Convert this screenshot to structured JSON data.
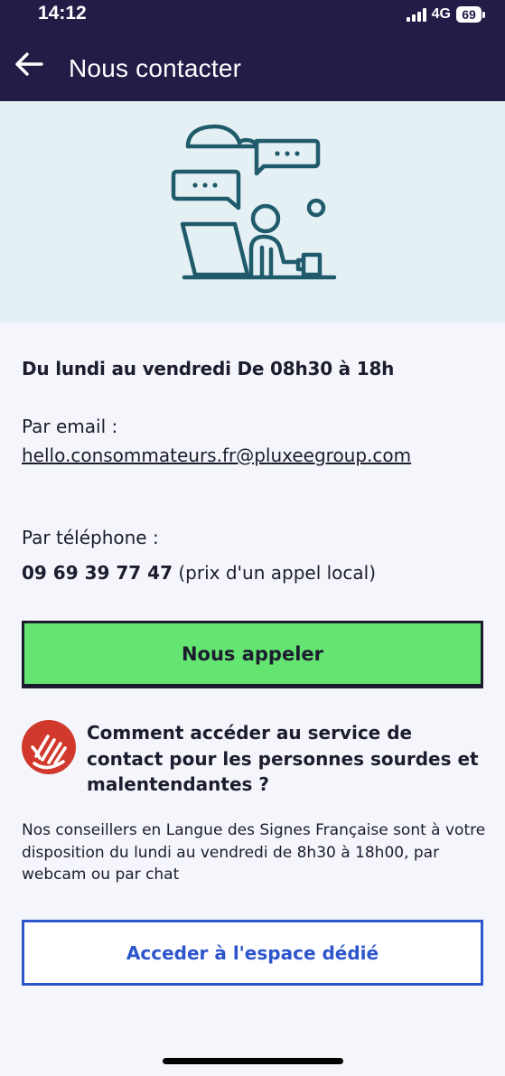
{
  "status_bar": {
    "time": "14:12",
    "network": "4G",
    "battery": "69"
  },
  "header": {
    "title": "Nous contacter",
    "back_icon": "arrow-left-icon"
  },
  "contact": {
    "hours": "Du lundi au vendredi De 08h30 à 18h",
    "email_label": "Par email :",
    "email": "hello.consommateurs.fr@pluxeegroup.com",
    "phone_label": "Par téléphone :",
    "phone_number": "09 69 39 77 47",
    "phone_note": " (prix d'un appel local)"
  },
  "call_button": {
    "label": "Nous appeler"
  },
  "deaf_service": {
    "icon": "sign-language-hand-icon",
    "title": "Comment accéder au service de contact pour les personnes sourdes et malentendantes ?",
    "description": "Nos conseillers en Langue des Signes Française sont à votre disposition du lundi au vendredi de 8h30 à 18h00, par webcam ou par chat",
    "button_label": "Acceder à l'espace dédié"
  },
  "colors": {
    "header_bg": "#221c47",
    "hero_bg": "#e5f0f5",
    "call_button_bg": "#64e572",
    "dedicated_button": "#2d55cc",
    "deaf_icon": "#d0392b"
  }
}
